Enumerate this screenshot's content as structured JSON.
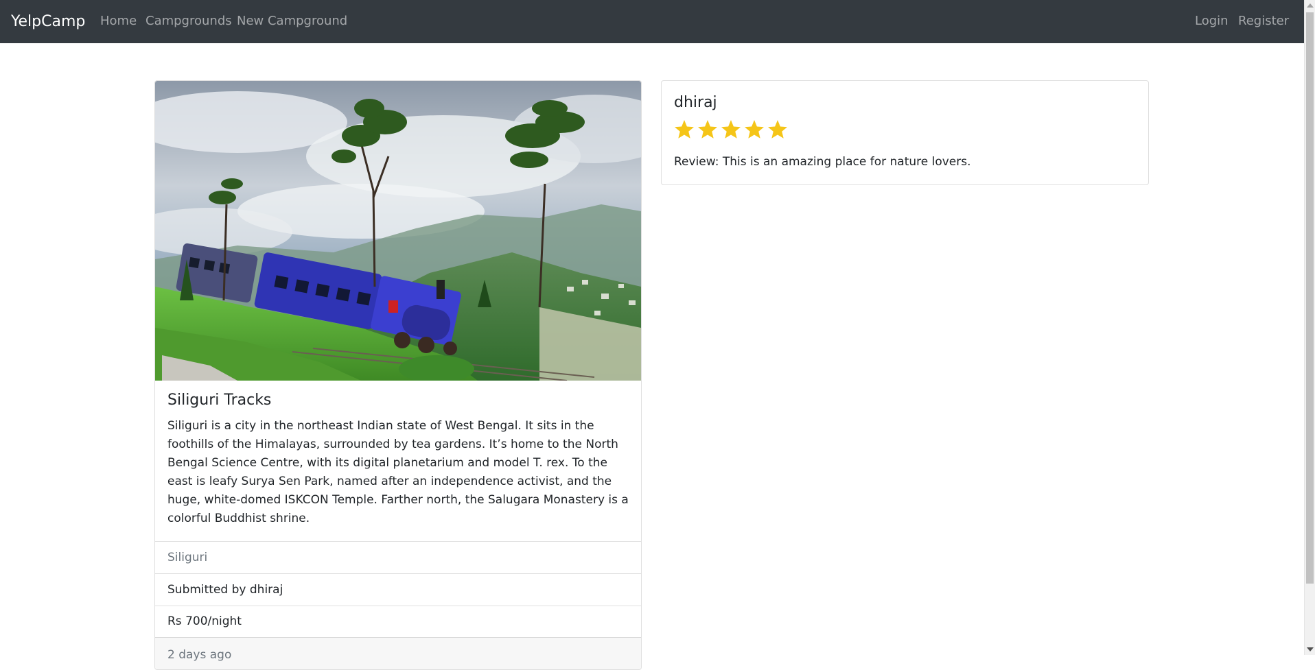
{
  "navbar": {
    "brand": "YelpCamp",
    "links": [
      "Home",
      "Campgrounds",
      "New Campground"
    ],
    "auth_links": [
      "Login",
      "Register"
    ],
    "bg_color": "#343a40"
  },
  "campground": {
    "image_icon": "campground-photo-train-hills",
    "title": "Siliguri Tracks",
    "description": "Siliguri is a city in the northeast Indian state of West Bengal. It sits in the foothills of the Himalayas, surrounded by tea gardens. It’s home to the North Bengal Science Centre, with its digital planetarium and model T. rex. To the east is leafy Surya Sen Park, named after an independence activist, and the huge, white-domed ISKCON Temple. Farther north, the Salugara Monastery is a colorful Buddhist shrine.",
    "location": "Siliguri",
    "submitted_by": "Submitted by dhiraj",
    "price": "Rs 700/night",
    "posted": "2 days ago"
  },
  "review": {
    "author": "dhiraj",
    "rating": 5,
    "rating_max": 5,
    "star_color": "#f5c518",
    "text": "Review: This is an amazing place for nature lovers."
  }
}
